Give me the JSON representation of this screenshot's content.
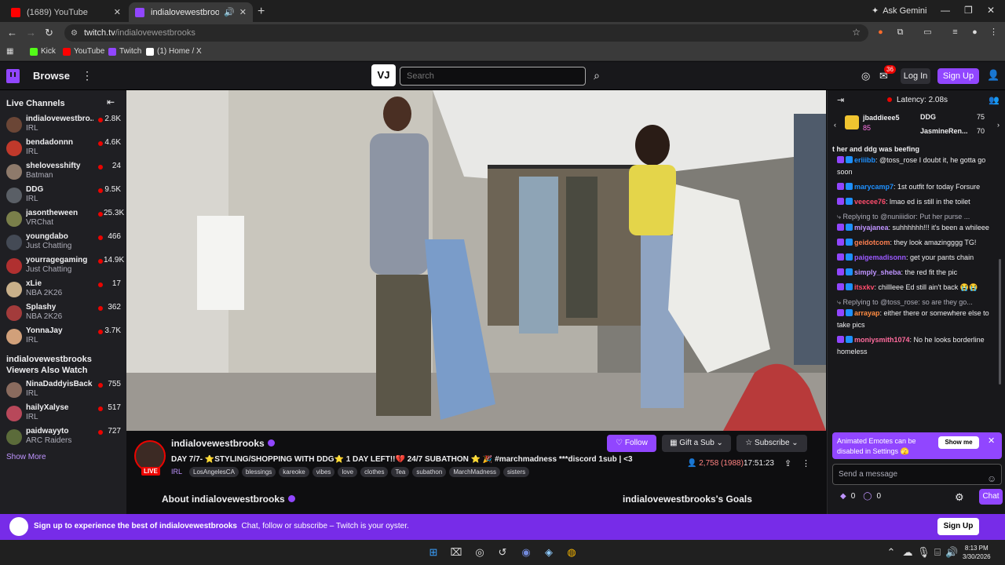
{
  "browser": {
    "tabs": [
      {
        "title": "(1689) YouTube",
        "favicon_color": "#ff0000"
      },
      {
        "title": "indialovewestbrooks - Twitch",
        "favicon_color": "#9146ff"
      }
    ],
    "new_tab": "+",
    "gemini": "Ask Gemini",
    "url_domain": "twitch.tv",
    "url_path": "/indialovewestbrooks",
    "bookmarks": [
      {
        "label": "Kick",
        "color": "#53fc18"
      },
      {
        "label": "YouTube",
        "color": "#ff0000"
      },
      {
        "label": "Twitch",
        "color": "#9146ff"
      },
      {
        "label": "(1) Home / X",
        "color": "#ffffff"
      }
    ]
  },
  "twitch": {
    "browse": "Browse",
    "search_placeholder": "Search",
    "notif_count": "36",
    "login": "Log In",
    "signup": "Sign Up"
  },
  "sidebar": {
    "live_header": "Live Channels",
    "channels": [
      {
        "name": "indialovewestbro...",
        "game": "IRL",
        "viewers": "2.8K",
        "color": "#6b4636"
      },
      {
        "name": "bendadonnn",
        "game": "IRL",
        "viewers": "4.6K",
        "color": "#c0392b"
      },
      {
        "name": "shelovesshifty",
        "game": "Batman",
        "viewers": "24",
        "color": "#8e7a6b"
      },
      {
        "name": "DDG",
        "game": "IRL",
        "viewers": "9.5K",
        "color": "#5a5f66"
      },
      {
        "name": "jasontheween",
        "game": "VRChat",
        "viewers": "25.3K",
        "color": "#7a7f4a"
      },
      {
        "name": "youngdabo",
        "game": "Just Chatting",
        "viewers": "466",
        "color": "#444a55"
      },
      {
        "name": "yourragegaming",
        "game": "Just Chatting",
        "viewers": "14.9K",
        "color": "#b03030"
      },
      {
        "name": "xLie",
        "game": "NBA 2K26",
        "viewers": "17",
        "color": "#c9b08a"
      },
      {
        "name": "Splashy",
        "game": "NBA 2K26",
        "viewers": "362",
        "color": "#a33b3b"
      },
      {
        "name": "YonnaJay",
        "game": "IRL",
        "viewers": "3.7K",
        "color": "#d1a07a"
      }
    ],
    "also_header": "indialovewestbrooks Viewers Also Watch",
    "also": [
      {
        "name": "NinaDaddyisBack",
        "game": "IRL",
        "viewers": "755",
        "color": "#8a6b5e"
      },
      {
        "name": "hailyXalyse",
        "game": "IRL",
        "viewers": "517",
        "color": "#b8485a"
      },
      {
        "name": "paidwayyto",
        "game": "ARC Raiders",
        "viewers": "727",
        "color": "#5b6b3a"
      }
    ],
    "show_more": "Show More"
  },
  "stream": {
    "name": "indialovewestbrooks",
    "live": "LIVE",
    "title": "DAY 7/7- ⭐STYLING/SHOPPING WITH DDG⭐ 1 DAY LEFT!!💔 24/7 SUBATHON ⭐ 🎉 #marchmadness ***discord 1sub | <3",
    "category": "IRL",
    "tags": [
      "LosAngelesCA",
      "blessings",
      "kareoke",
      "vibes",
      "love",
      "clothes",
      "Tea",
      "subathon",
      "MarchMadness",
      "sisters"
    ],
    "follow": "Follow",
    "gift": "Gift a Sub",
    "subscribe": "Subscribe",
    "viewers": "2,758 (1988)",
    "uptime": "17:51:23",
    "about": "About indialovewestbrooks",
    "goals": "indialovewestbrooks's Goals"
  },
  "chat": {
    "latency": "Latency: 2.08s",
    "leaderboard": [
      {
        "name": "jbaddieee5",
        "value": "85"
      },
      {
        "name": "DDG",
        "value": "75"
      },
      {
        "name": "JasmineRen...",
        "value": "70"
      }
    ],
    "pinned": "t her and ddg was beefing",
    "messages": [
      {
        "type": "msg",
        "user": "eriiibb",
        "color": "#1e90ff",
        "text": ": @toss_rose I doubt it, he gotta go soon"
      },
      {
        "type": "msg",
        "user": "marycamp7",
        "color": "#1e90ff",
        "text": ": 1st outfit for today Forsure"
      },
      {
        "type": "msg",
        "user": "veecee76",
        "color": "#ff4d6d",
        "text": ": lmao ed is still in the toilet"
      },
      {
        "type": "reply",
        "text": "Replying to @nuniiidior: Put her purse ..."
      },
      {
        "type": "msg",
        "user": "miyajanea",
        "color": "#bf94ff",
        "text": ": suhhhhhh!!! it's been a whileee"
      },
      {
        "type": "msg",
        "user": "geidotcom",
        "color": "#ff7f50",
        "text": ": they look amazingggg TG!"
      },
      {
        "type": "msg",
        "user": "paigemadisonn",
        "color": "#9b59ff",
        "text": ": get your pants chain"
      },
      {
        "type": "msg",
        "user": "simply_sheba",
        "color": "#bf94ff",
        "text": ": the red fit the pic"
      },
      {
        "type": "msg",
        "user": "itsxkv",
        "color": "#ff4d6d",
        "text": ": chillleee Ed still ain't back 😭😭"
      },
      {
        "type": "reply",
        "text": "Replying to @toss_rose: so are they go..."
      },
      {
        "type": "msg",
        "user": "arrayap",
        "color": "#ff8c42",
        "text": ": either there or somewhere else to take pics"
      },
      {
        "type": "msg",
        "user": "moniysmith1074",
        "color": "#ff6b9d",
        "text": ": No he looks borderline homeless"
      }
    ],
    "notice": "Animated Emotes can be disabled in Settings 🫣",
    "show_me": "Show me",
    "input_placeholder": "Send a message",
    "points_a": "0",
    "points_b": "0",
    "chat_button": "Chat"
  },
  "banner": {
    "bold": "Sign up to experience the best of indialovewestbrooks",
    "rest": "Chat, follow or subscribe – Twitch is your oyster.",
    "button": "Sign Up"
  },
  "taskbar": {
    "time": "8:13 PM",
    "date": "3/30/2026"
  }
}
